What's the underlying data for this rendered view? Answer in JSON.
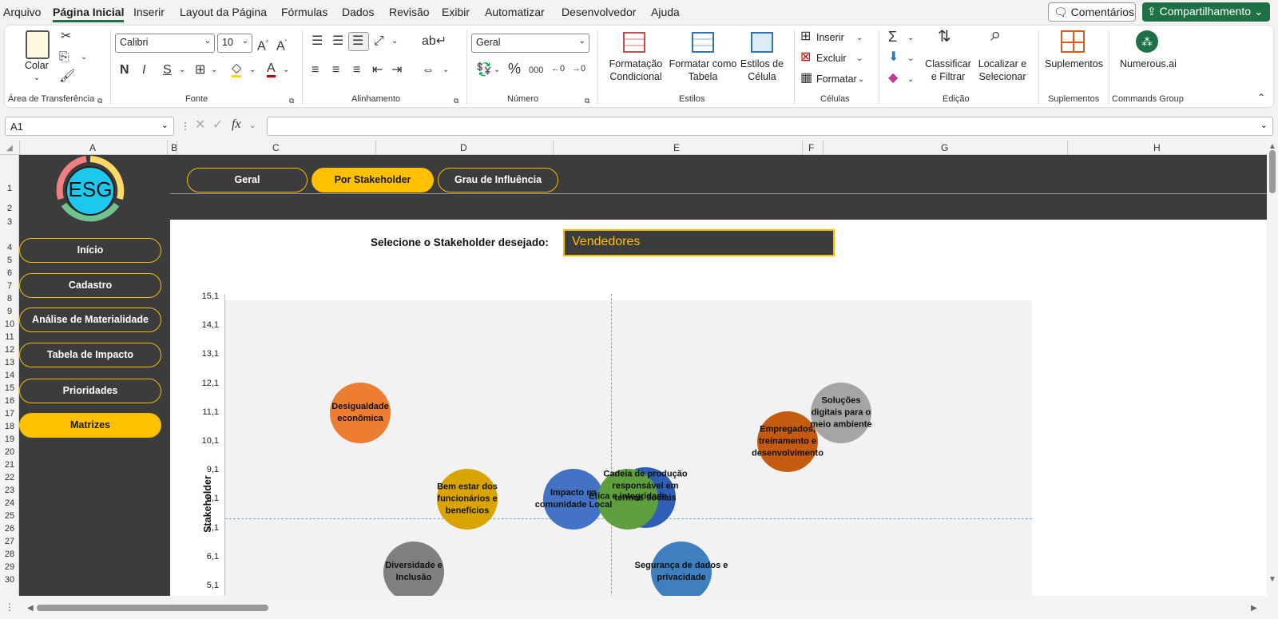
{
  "menu": {
    "items": [
      "Arquivo",
      "Página Inicial",
      "Inserir",
      "Layout da Página",
      "Fórmulas",
      "Dados",
      "Revisão",
      "Exibir",
      "Automatizar",
      "Desenvolvedor",
      "Ajuda"
    ],
    "active": "Página Inicial",
    "comments": "Comentários",
    "share": "Compartilhamento"
  },
  "ribbon": {
    "clipboard": {
      "paste": "Colar",
      "group": "Área de Transferência"
    },
    "font": {
      "name": "Calibri",
      "size": "10",
      "group": "Fonte"
    },
    "alignment": {
      "group": "Alinhamento"
    },
    "number": {
      "format": "Geral",
      "group": "Número",
      "thousands": "000"
    },
    "styles": {
      "conditional": "Formatação Condicional",
      "table": "Formatar como Tabela",
      "cell": "Estilos de Célula",
      "group": "Estilos"
    },
    "cells": {
      "insert": "Inserir",
      "delete": "Excluir",
      "format": "Formatar",
      "group": "Células"
    },
    "editing": {
      "sort": "Classificar e Filtrar",
      "find": "Localizar e Selecionar",
      "group": "Edição"
    },
    "addins": {
      "label": "Suplementos",
      "group": "Suplementos"
    },
    "commands": {
      "label": "Numerous.ai",
      "group": "Commands Group"
    }
  },
  "formula_bar": {
    "name_box": "A1",
    "fx": "fx"
  },
  "columns": [
    "A",
    "B",
    "C",
    "D",
    "E",
    "F",
    "G",
    "H"
  ],
  "rows": [
    "1",
    "2",
    "3",
    "4",
    "5",
    "6",
    "7",
    "8",
    "9",
    "10",
    "11",
    "12",
    "13",
    "14",
    "15",
    "16",
    "17",
    "18",
    "19",
    "20",
    "21",
    "22",
    "23",
    "24",
    "25",
    "26",
    "27",
    "28",
    "29",
    "30"
  ],
  "dashboard": {
    "logo_text": "ESG",
    "tabs": [
      "Geral",
      "Por Stakeholder",
      "Grau de Influência"
    ],
    "active_tab": "Por Stakeholder",
    "nav": [
      "Início",
      "Cadastro",
      "Análise de Materialidade",
      "Tabela de Impacto",
      "Prioridades",
      "Matrizes"
    ],
    "active_nav": "Matrizes",
    "stakeholder_label": "Selecione o Stakeholder desejado:",
    "stakeholder_value": "Vendedores"
  },
  "chart_data": {
    "type": "scatter",
    "ylabel": "Stakeholder",
    "yticks": [
      "15,1",
      "14,1",
      "13,1",
      "12,1",
      "11,1",
      "10,1",
      "9,1",
      "8,1",
      "7,1",
      "6,1",
      "5,1"
    ],
    "ylim": [
      5.1,
      15.1
    ],
    "grid": false,
    "points": [
      {
        "label": "Desigualdade econômica",
        "y": 11.1,
        "color": "#ed7d31"
      },
      {
        "label": "Bem estar dos funcionários e benefícios",
        "y": 8.1,
        "color": "#d9a400"
      },
      {
        "label": "Impacto na comunidade Local",
        "y": 8.1,
        "color": "#4472c4"
      },
      {
        "label": "Cadeia de produção responsável em termos sociais",
        "y": 8.4,
        "color": "#2e5eb5"
      },
      {
        "label": "Ética e integridade",
        "y": 8.1,
        "color": "#5e9e3c"
      },
      {
        "label": "Empregados, treinamento e desenvolvimento",
        "y": 10.1,
        "color": "#c55a11"
      },
      {
        "label": "Soluções digitais para o meio ambiente",
        "y": 11.1,
        "color": "#a5a5a5"
      },
      {
        "label": "Diversidade e Inclusão",
        "y": 5.6,
        "color": "#7f7f7f"
      },
      {
        "label": "Segurança de dados e privacidade",
        "y": 5.6,
        "color": "#3f7fbf"
      }
    ]
  }
}
